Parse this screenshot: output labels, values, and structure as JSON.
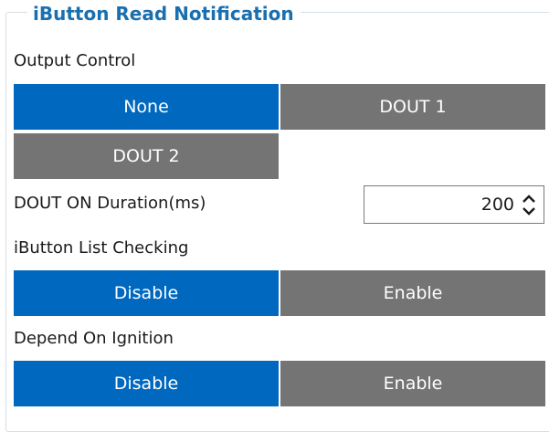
{
  "group": {
    "title": "iButton Read Notification"
  },
  "output_control": {
    "label": "Output Control",
    "options": [
      "None",
      "DOUT 1",
      "DOUT 2"
    ],
    "selected": "None"
  },
  "dout_duration": {
    "label": "DOUT ON Duration(ms)",
    "value": "200"
  },
  "ibutton_list_checking": {
    "label": "iButton List Checking",
    "options": [
      "Disable",
      "Enable"
    ],
    "selected": "Disable"
  },
  "depend_on_ignition": {
    "label": "Depend On Ignition",
    "options": [
      "Disable",
      "Enable"
    ],
    "selected": "Disable"
  },
  "colors": {
    "selected": "#0068bf",
    "unselected": "#747474",
    "title": "#1a6fb0"
  }
}
